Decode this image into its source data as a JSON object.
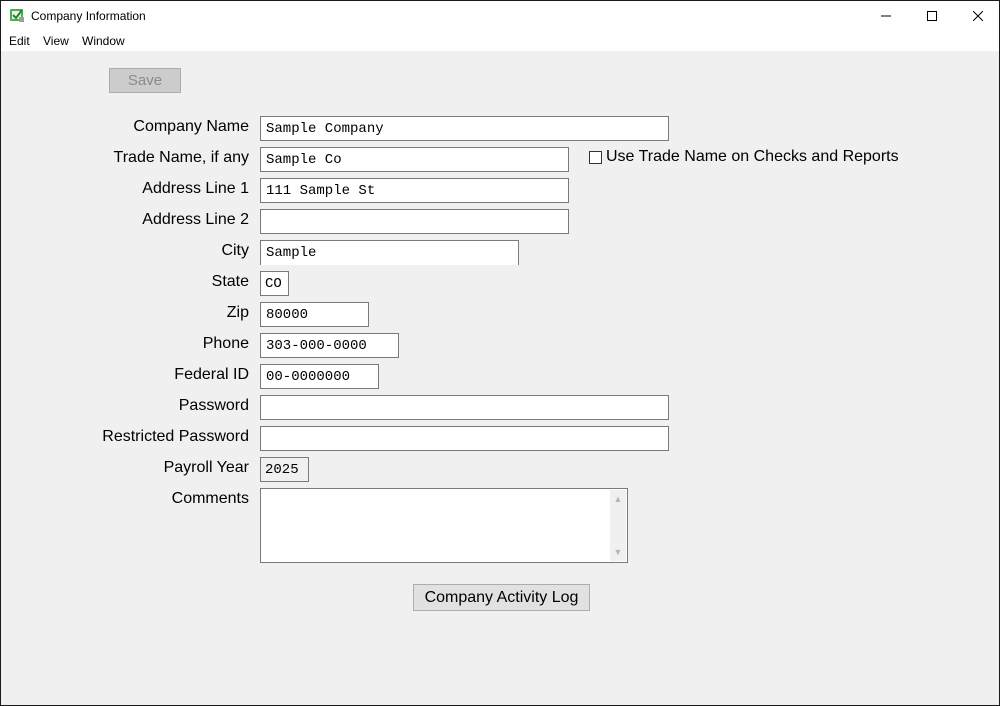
{
  "window": {
    "title": "Company Information",
    "icon": "checkbook-app-icon",
    "controls": {
      "minimize": "—",
      "maximize": "☐",
      "close": "✕"
    }
  },
  "menu": [
    {
      "label": "Edit"
    },
    {
      "label": "View"
    },
    {
      "label": "Window"
    }
  ],
  "toolbar": {
    "save_label": "Save",
    "save_enabled": false
  },
  "form": {
    "company_name": {
      "label": "Company Name",
      "value": "Sample Company"
    },
    "trade_name": {
      "label": "Trade Name, if any",
      "value": "Sample Co"
    },
    "use_trade_name": {
      "label": "Use Trade Name on Checks and Reports",
      "checked": false
    },
    "address1": {
      "label": "Address Line 1",
      "value": "111 Sample St"
    },
    "address2": {
      "label": "Address Line 2",
      "value": ""
    },
    "city": {
      "label": "City",
      "value": "Sample"
    },
    "state": {
      "label": "State",
      "value": "CO"
    },
    "zip": {
      "label": "Zip",
      "value": "80000"
    },
    "phone": {
      "label": "Phone",
      "value": "303-000-0000"
    },
    "federal_id": {
      "label": "Federal ID",
      "value": "00-0000000"
    },
    "password": {
      "label": "Password",
      "value": ""
    },
    "restricted_password": {
      "label": "Restricted Password",
      "value": ""
    },
    "payroll_year": {
      "label": "Payroll Year",
      "value": "2025"
    },
    "comments": {
      "label": "Comments",
      "value": ""
    }
  },
  "actions": {
    "activity_log_label": "Company Activity Log"
  },
  "icons": {
    "scroll_up": "▲",
    "scroll_down": "▼"
  }
}
